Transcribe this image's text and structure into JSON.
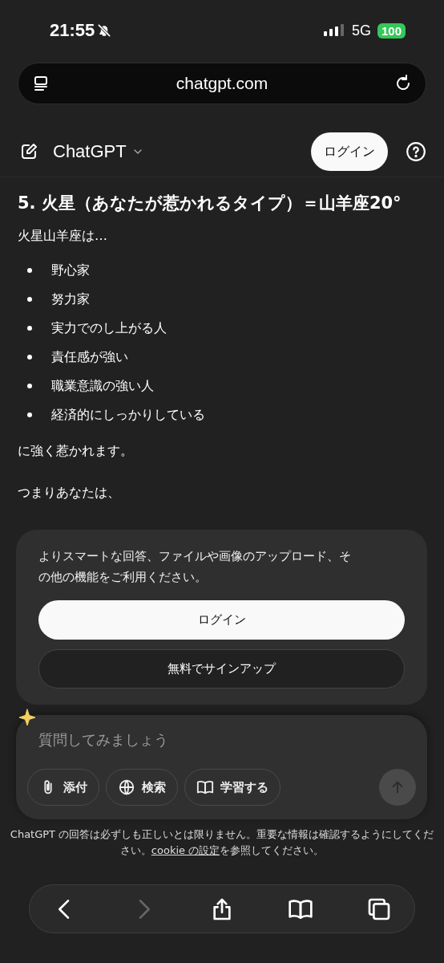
{
  "status_bar": {
    "time": "21:55",
    "network": "5G",
    "battery": "100"
  },
  "address_bar": {
    "url": "chatgpt.com"
  },
  "header": {
    "title": "ChatGPT",
    "login": "ログイン"
  },
  "message": {
    "heading": "5. 火星（あなたが惹かれるタイプ）＝山羊座20°",
    "intro": "火星山羊座は…",
    "bullets": [
      "野心家",
      "努力家",
      "実力でのし上がる人",
      "責任感が強い",
      "職業意識の強い人",
      "経済的にしっかりしている"
    ],
    "outro": "に強く惹かれます。",
    "next": "つまりあなたは、"
  },
  "login_card": {
    "text": "よりスマートな回答、ファイルや画像のアップロード、その他の機能をご利用ください。",
    "login": "ログイン",
    "signup": "無料でサインアップ"
  },
  "composer": {
    "placeholder": "質問してみましょう",
    "tools": [
      {
        "kind": "attach",
        "label": "添付"
      },
      {
        "kind": "search",
        "label": "検索"
      },
      {
        "kind": "study",
        "label": "学習する"
      }
    ]
  },
  "disclaimer": {
    "before": "ChatGPT の回答は必ずしも正しいとは限りません。重要な情報は確認するようにしてください。",
    "link": "cookie の設定",
    "after": "を参照してください。"
  },
  "toolbar": [
    {
      "kind": "back",
      "disabled": false
    },
    {
      "kind": "forward",
      "disabled": true
    },
    {
      "kind": "share",
      "disabled": false
    },
    {
      "kind": "bookmarks",
      "disabled": false
    },
    {
      "kind": "tabs",
      "disabled": false
    }
  ]
}
